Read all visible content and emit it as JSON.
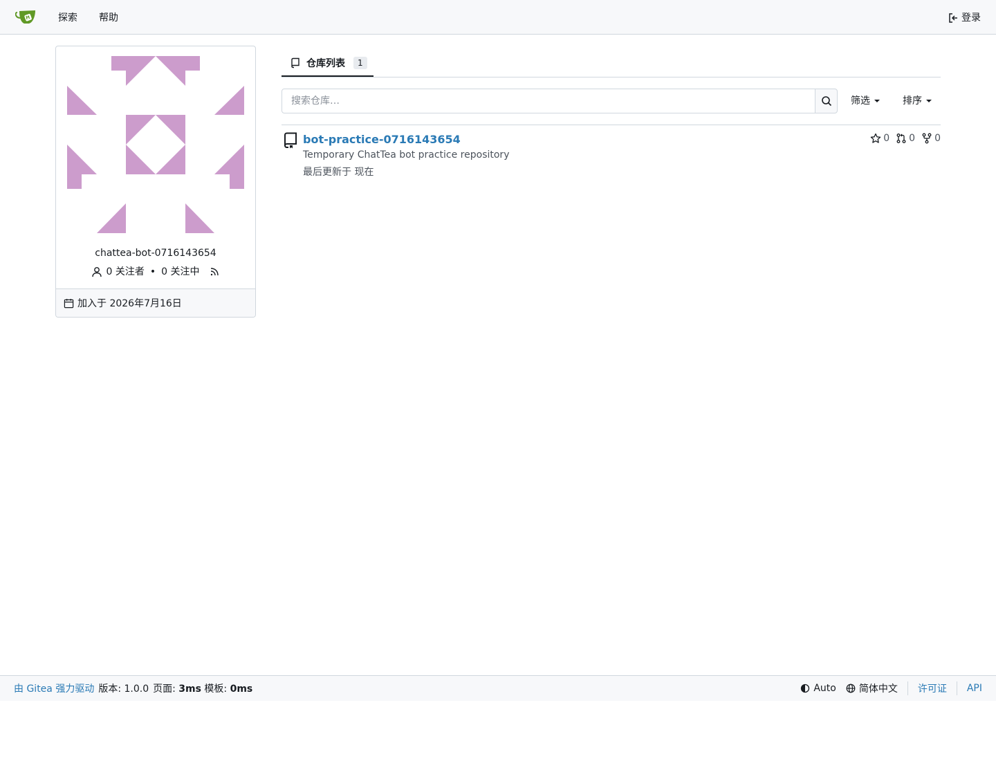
{
  "navbar": {
    "logo_icon": "gitea-teacup-icon",
    "explore": "探索",
    "help": "帮助",
    "login": "登录"
  },
  "profile": {
    "avatar_color": "#cc9ccc",
    "username": "chattea-bot-0716143654",
    "followers": "0 关注者",
    "separator": "•",
    "following": "0 关注中",
    "joined": "加入于 2026年7月16日"
  },
  "tabs": [
    {
      "label": "仓库列表",
      "count": "1"
    }
  ],
  "search": {
    "placeholder": "搜索仓库…",
    "filter_label": "筛选",
    "sort_label": "排序"
  },
  "repos": [
    {
      "name": "bot-practice-0716143654",
      "description": "Temporary ChatTea bot practice repository",
      "updated": "最后更新于 现在",
      "stars": "0",
      "pulls": "0",
      "forks": "0"
    }
  ],
  "footer": {
    "powered_by": "由 Gitea 强力驱动",
    "version_label": "版本: 1.0.0",
    "page_label": "页面:",
    "page_time": "3ms",
    "template_label": "模板:",
    "template_time": "0ms",
    "theme": "Auto",
    "language": "简体中文",
    "license": "许可证",
    "api": "API"
  },
  "colors": {
    "link": "#2a7ab5",
    "accent_green": "#609926",
    "border": "#d0d7de"
  }
}
